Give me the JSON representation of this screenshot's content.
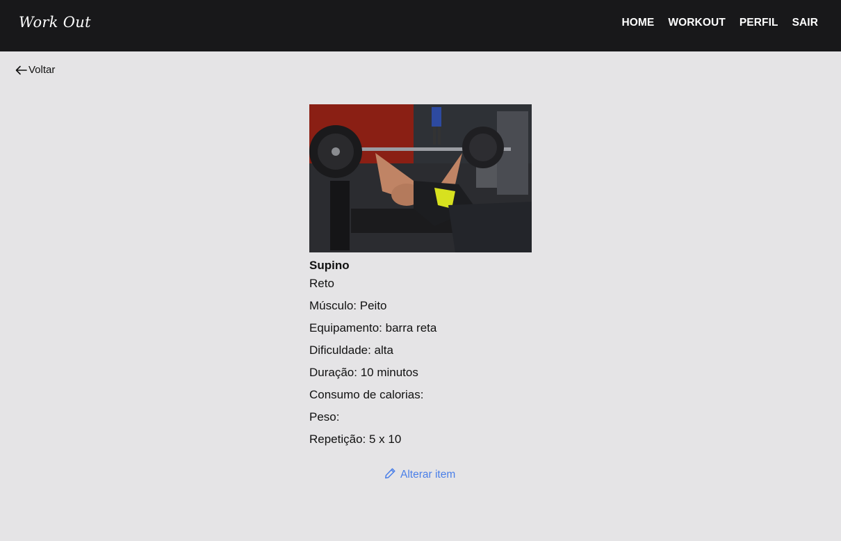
{
  "header": {
    "brand": "Work Out",
    "nav": [
      "HOME",
      "WORKOUT",
      "PERFIL",
      "SAIR"
    ]
  },
  "back": {
    "label": "Voltar",
    "icon": "arrow-left-icon"
  },
  "exercise": {
    "image_alt": "bench press photo",
    "title": "Supino",
    "subtitle": "Reto",
    "details": [
      "Músculo: Peito",
      "Equipamento: barra reta",
      "Dificuldade: alta",
      "Duração: 10 minutos",
      "Consumo de calorias:",
      "Peso:",
      "Repetição: 5 x 10"
    ]
  },
  "actions": {
    "edit_label": "Alterar item",
    "edit_icon": "pencil-icon"
  },
  "colors": {
    "header_bg": "#18181a",
    "page_bg": "#e5e4e6",
    "link_blue": "#4a7fe8"
  }
}
